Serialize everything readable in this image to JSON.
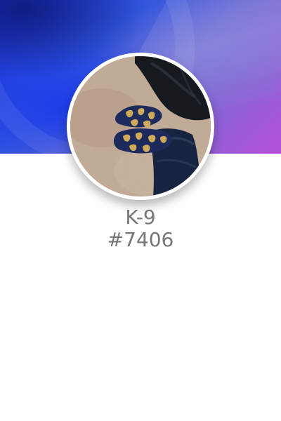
{
  "profile": {
    "username": "K-9",
    "discriminator": "#7406"
  },
  "colors": {
    "name_text": "#777777",
    "banner_start": "#1a2ed6",
    "banner_end": "#b54fd8",
    "avatar_ring": "#ffffff"
  }
}
